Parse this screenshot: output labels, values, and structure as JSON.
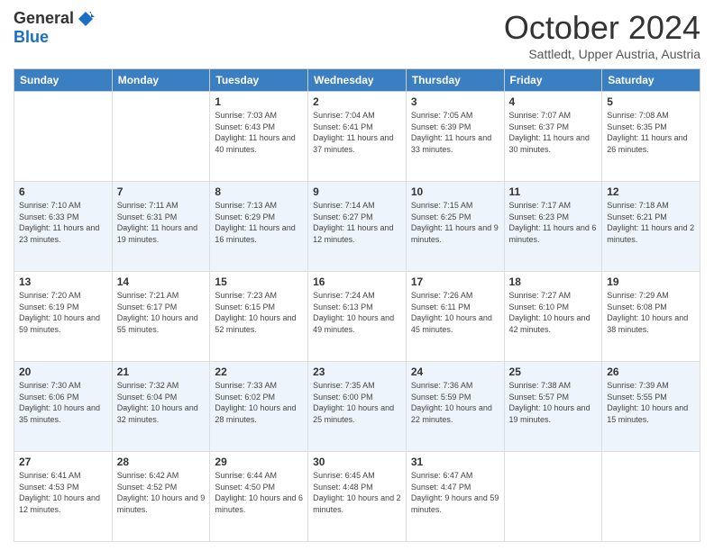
{
  "logo": {
    "general": "General",
    "blue": "Blue"
  },
  "header": {
    "month": "October 2024",
    "location": "Sattledt, Upper Austria, Austria"
  },
  "days_of_week": [
    "Sunday",
    "Monday",
    "Tuesday",
    "Wednesday",
    "Thursday",
    "Friday",
    "Saturday"
  ],
  "weeks": [
    [
      {
        "day": "",
        "info": ""
      },
      {
        "day": "",
        "info": ""
      },
      {
        "day": "1",
        "info": "Sunrise: 7:03 AM\nSunset: 6:43 PM\nDaylight: 11 hours and 40 minutes."
      },
      {
        "day": "2",
        "info": "Sunrise: 7:04 AM\nSunset: 6:41 PM\nDaylight: 11 hours and 37 minutes."
      },
      {
        "day": "3",
        "info": "Sunrise: 7:05 AM\nSunset: 6:39 PM\nDaylight: 11 hours and 33 minutes."
      },
      {
        "day": "4",
        "info": "Sunrise: 7:07 AM\nSunset: 6:37 PM\nDaylight: 11 hours and 30 minutes."
      },
      {
        "day": "5",
        "info": "Sunrise: 7:08 AM\nSunset: 6:35 PM\nDaylight: 11 hours and 26 minutes."
      }
    ],
    [
      {
        "day": "6",
        "info": "Sunrise: 7:10 AM\nSunset: 6:33 PM\nDaylight: 11 hours and 23 minutes."
      },
      {
        "day": "7",
        "info": "Sunrise: 7:11 AM\nSunset: 6:31 PM\nDaylight: 11 hours and 19 minutes."
      },
      {
        "day": "8",
        "info": "Sunrise: 7:13 AM\nSunset: 6:29 PM\nDaylight: 11 hours and 16 minutes."
      },
      {
        "day": "9",
        "info": "Sunrise: 7:14 AM\nSunset: 6:27 PM\nDaylight: 11 hours and 12 minutes."
      },
      {
        "day": "10",
        "info": "Sunrise: 7:15 AM\nSunset: 6:25 PM\nDaylight: 11 hours and 9 minutes."
      },
      {
        "day": "11",
        "info": "Sunrise: 7:17 AM\nSunset: 6:23 PM\nDaylight: 11 hours and 6 minutes."
      },
      {
        "day": "12",
        "info": "Sunrise: 7:18 AM\nSunset: 6:21 PM\nDaylight: 11 hours and 2 minutes."
      }
    ],
    [
      {
        "day": "13",
        "info": "Sunrise: 7:20 AM\nSunset: 6:19 PM\nDaylight: 10 hours and 59 minutes."
      },
      {
        "day": "14",
        "info": "Sunrise: 7:21 AM\nSunset: 6:17 PM\nDaylight: 10 hours and 55 minutes."
      },
      {
        "day": "15",
        "info": "Sunrise: 7:23 AM\nSunset: 6:15 PM\nDaylight: 10 hours and 52 minutes."
      },
      {
        "day": "16",
        "info": "Sunrise: 7:24 AM\nSunset: 6:13 PM\nDaylight: 10 hours and 49 minutes."
      },
      {
        "day": "17",
        "info": "Sunrise: 7:26 AM\nSunset: 6:11 PM\nDaylight: 10 hours and 45 minutes."
      },
      {
        "day": "18",
        "info": "Sunrise: 7:27 AM\nSunset: 6:10 PM\nDaylight: 10 hours and 42 minutes."
      },
      {
        "day": "19",
        "info": "Sunrise: 7:29 AM\nSunset: 6:08 PM\nDaylight: 10 hours and 38 minutes."
      }
    ],
    [
      {
        "day": "20",
        "info": "Sunrise: 7:30 AM\nSunset: 6:06 PM\nDaylight: 10 hours and 35 minutes."
      },
      {
        "day": "21",
        "info": "Sunrise: 7:32 AM\nSunset: 6:04 PM\nDaylight: 10 hours and 32 minutes."
      },
      {
        "day": "22",
        "info": "Sunrise: 7:33 AM\nSunset: 6:02 PM\nDaylight: 10 hours and 28 minutes."
      },
      {
        "day": "23",
        "info": "Sunrise: 7:35 AM\nSunset: 6:00 PM\nDaylight: 10 hours and 25 minutes."
      },
      {
        "day": "24",
        "info": "Sunrise: 7:36 AM\nSunset: 5:59 PM\nDaylight: 10 hours and 22 minutes."
      },
      {
        "day": "25",
        "info": "Sunrise: 7:38 AM\nSunset: 5:57 PM\nDaylight: 10 hours and 19 minutes."
      },
      {
        "day": "26",
        "info": "Sunrise: 7:39 AM\nSunset: 5:55 PM\nDaylight: 10 hours and 15 minutes."
      }
    ],
    [
      {
        "day": "27",
        "info": "Sunrise: 6:41 AM\nSunset: 4:53 PM\nDaylight: 10 hours and 12 minutes."
      },
      {
        "day": "28",
        "info": "Sunrise: 6:42 AM\nSunset: 4:52 PM\nDaylight: 10 hours and 9 minutes."
      },
      {
        "day": "29",
        "info": "Sunrise: 6:44 AM\nSunset: 4:50 PM\nDaylight: 10 hours and 6 minutes."
      },
      {
        "day": "30",
        "info": "Sunrise: 6:45 AM\nSunset: 4:48 PM\nDaylight: 10 hours and 2 minutes."
      },
      {
        "day": "31",
        "info": "Sunrise: 6:47 AM\nSunset: 4:47 PM\nDaylight: 9 hours and 59 minutes."
      },
      {
        "day": "",
        "info": ""
      },
      {
        "day": "",
        "info": ""
      }
    ]
  ]
}
